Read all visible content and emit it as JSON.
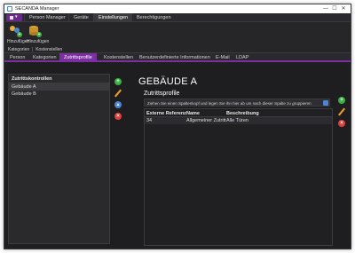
{
  "window": {
    "title": "SECANDA Manager"
  },
  "window_controls": {
    "minimize": "—",
    "maximize": "☐",
    "close": "✕"
  },
  "menu": {
    "app_button_caret": "▾",
    "tabs": [
      "Person Manager",
      "Geräte",
      "Einstellungen",
      "Berechtigungen"
    ],
    "active_tab": "Einstellungen"
  },
  "ribbon": {
    "buttons": [
      {
        "label": "Hinzufügen",
        "icon": "add-people-icon"
      },
      {
        "label": "Hinzufügen",
        "icon": "add-database-icon"
      }
    ],
    "groups": [
      "Kategorien",
      "Kostenstellen"
    ]
  },
  "subtabs": {
    "items": [
      "Person",
      "Kategorien",
      "Zutrittsprofile",
      "Kostenstellen",
      "Benutzerdefinierte Informationen",
      "E-Mail",
      "LDAP"
    ],
    "active": "Zutrittsprofile"
  },
  "left_panel": {
    "header": "Zutrittskontrollen",
    "items": [
      "Gebäude A",
      "Gebäude B"
    ],
    "selected": "Gebäude A"
  },
  "main": {
    "title": "GEBÄUDE A",
    "subtitle": "Zutrittsprofile",
    "group_hint": "Ziehen Sie einen Spaltenkopf und legen Sie ihn hier ab um nach dieser Spalte zu gruppieren",
    "columns": [
      "Externe Referenz",
      "Name",
      "Beschreibung"
    ],
    "rows": [
      {
        "ref": "34",
        "name": "Allgemeiner Zutritt",
        "desc": "Alle Türen"
      }
    ]
  },
  "colors": {
    "accent": "#7b2fa0",
    "background": "#1e1e21",
    "add": "#3cb043",
    "delete": "#e0403c",
    "edit": "#f0a020"
  }
}
